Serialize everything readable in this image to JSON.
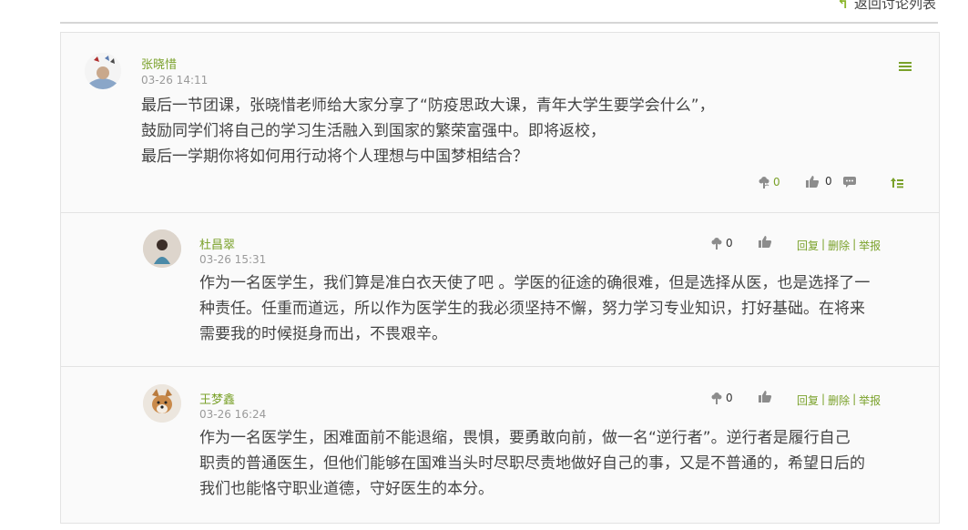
{
  "header": {
    "back_label": "返回讨论列表"
  },
  "post": {
    "author": "张晓惜",
    "time": "03-26 14:11",
    "lines": [
      "最后一节团课，张晓惜老师给大家分享了“防疫思政大课，青年大学生要学会什么”，",
      "鼓励同学们将自己的学习生活融入到国家的繁荣富强中。即将返校，",
      "最后一学期你将如何用行动将个人理想与中国梦相结合？"
    ],
    "flower_count": "0",
    "like_count": "0"
  },
  "replies": [
    {
      "author": "杜昌翠",
      "time": "03-26 15:31",
      "lines": [
        "作为一名医学生，我们算是准白衣天使了吧 。学医的征途的确很难，但是选择从医，也是选择了一",
        "种责任。任重而道远，所以作为医学生的我必须坚持不懈，努力学习专业知识，打好基础。在将来",
        "需要我的时候挺身而出，不畏艰辛。"
      ],
      "flower_count": "0",
      "actions": [
        "回复",
        "删除",
        "举报"
      ]
    },
    {
      "author": "王梦鑫",
      "time": "03-26 16:24",
      "lines": [
        "作为一名医学生，困难面前不能退缩，畏惧，要勇敢向前，做一名“逆行者”。逆行者是履行自己",
        "职责的普通医生，但他们能够在国难当头时尽职尽责地做好自己的事，又是不普通的，希望日后的",
        "我们也能恪守职业道德，守好医生的本分。"
      ],
      "flower_count": "0",
      "actions": [
        "回复",
        "删除",
        "举报"
      ]
    }
  ],
  "colors": {
    "accent": "#7aa12a",
    "icon": "#8c8c8c"
  }
}
